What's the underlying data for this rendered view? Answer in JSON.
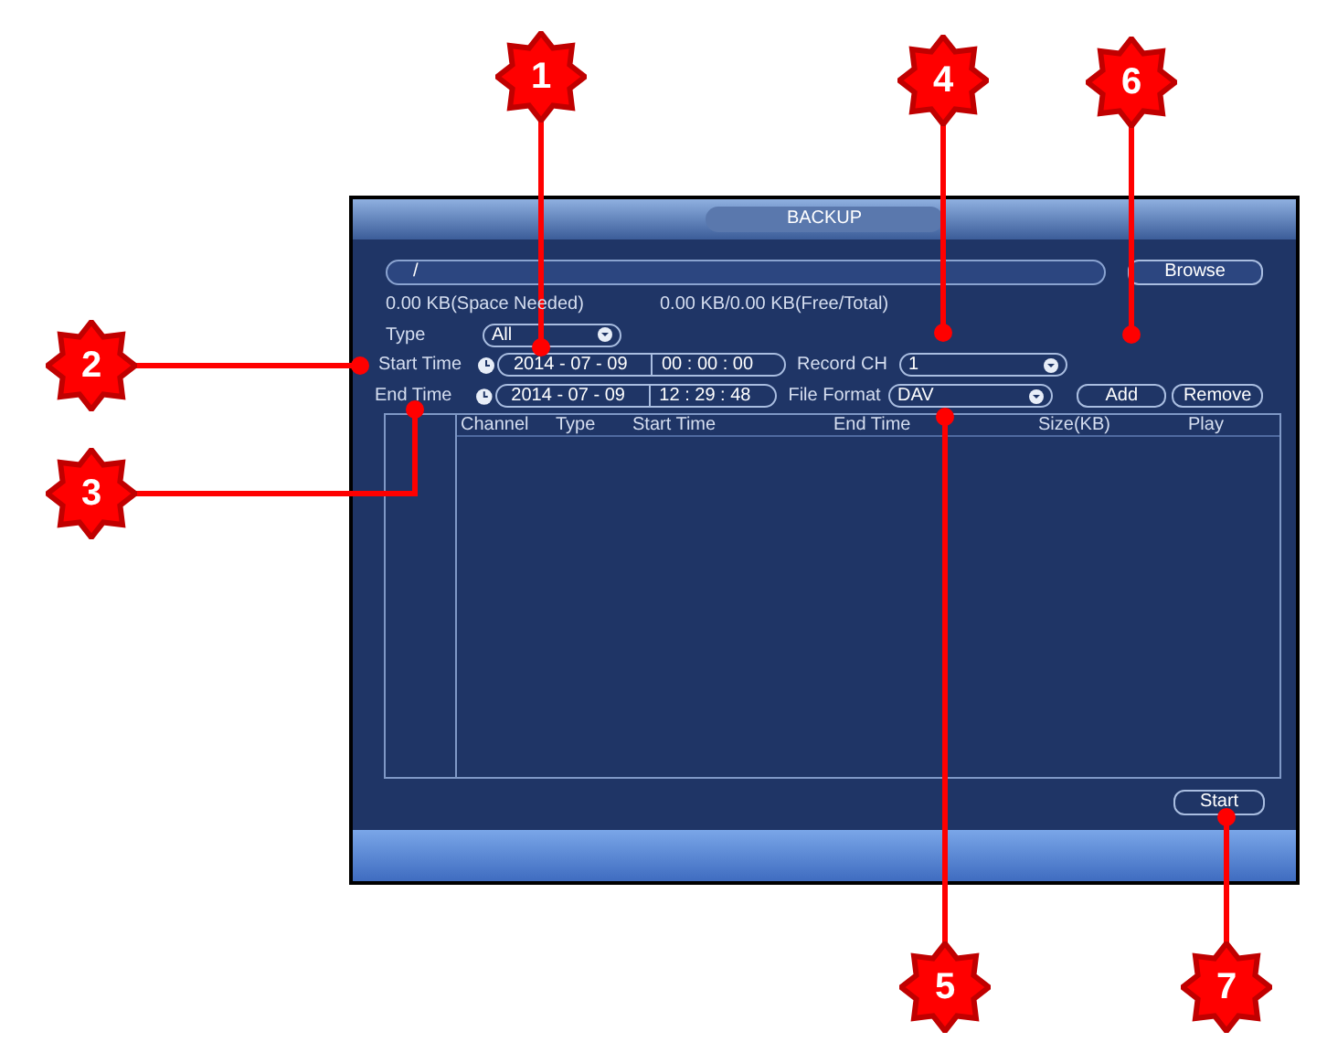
{
  "callouts": [
    {
      "label": "1"
    },
    {
      "label": "4"
    },
    {
      "label": "6"
    },
    {
      "label": "2"
    },
    {
      "label": "3"
    },
    {
      "label": "5"
    },
    {
      "label": "7"
    }
  ],
  "window": {
    "title": "BACKUP"
  },
  "path_field": {
    "value": "/"
  },
  "browse_button": "Browse",
  "space_needed": "0.00 KB(Space Needed)",
  "free_total": "0.00 KB/0.00 KB(Free/Total)",
  "type": {
    "label": "Type",
    "value": "All"
  },
  "start_time": {
    "label": "Start Time",
    "date": "2014 - 07 - 09",
    "time": "00 : 00 : 00"
  },
  "record_ch": {
    "label": "Record CH",
    "value": "1"
  },
  "end_time": {
    "label": "End Time",
    "date": "2014 - 07 - 09",
    "time": "12 : 29 : 48"
  },
  "file_format": {
    "label": "File Format",
    "value": "DAV"
  },
  "add_button": "Add",
  "remove_button": "Remove",
  "table": {
    "columns": [
      "Channel",
      "Type",
      "Start Time",
      "End Time",
      "Size(KB)",
      "Play"
    ]
  },
  "start_button": "Start"
}
